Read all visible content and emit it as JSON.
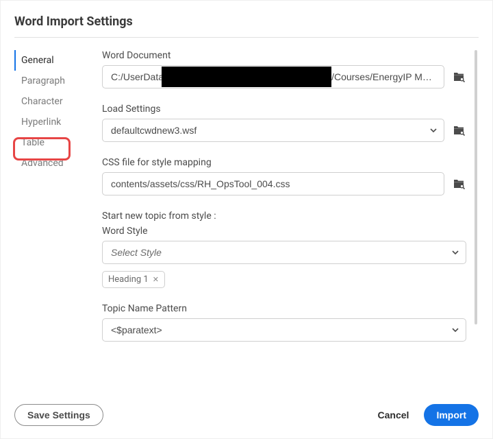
{
  "dialog": {
    "title": "Word Import Settings"
  },
  "sidebar": {
    "items": [
      {
        "label": "General"
      },
      {
        "label": "Paragraph"
      },
      {
        "label": "Character"
      },
      {
        "label": "Hyperlink"
      },
      {
        "label": "Table"
      },
      {
        "label": "Advanced"
      }
    ]
  },
  "fields": {
    "word_doc": {
      "label": "Word Document",
      "value": "C:/UserData/                                                             t/Courses/EnergyIP M…"
    },
    "load_settings": {
      "label": "Load Settings",
      "value": "defaultcwdnew3.wsf"
    },
    "css_file": {
      "label": "CSS file for style mapping",
      "value": "contents/assets/css/RH_OpsTool_004.css"
    },
    "start_topic": {
      "label": "Start new topic from style :",
      "sublabel": "Word Style",
      "value": "Select Style",
      "chip": "Heading 1"
    },
    "topic_pattern": {
      "label": "Topic Name Pattern",
      "value": "<$paratext>"
    }
  },
  "footer": {
    "save": "Save Settings",
    "cancel": "Cancel",
    "import": "Import"
  }
}
